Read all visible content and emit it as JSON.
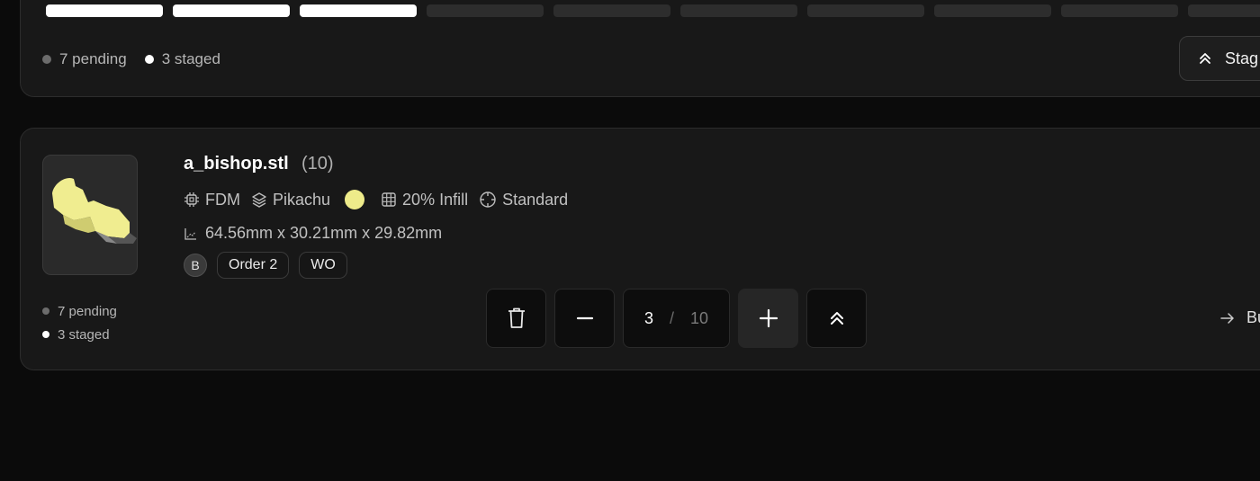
{
  "top_card": {
    "progress": {
      "segments_total": 10,
      "segments_filled": 3
    },
    "pending_label": "7 pending",
    "staged_label": "3 staged",
    "stage_button_label": "Stag"
  },
  "item": {
    "filename": "a_bishop.stl",
    "count": "(10)",
    "tech": "FDM",
    "material": "Pikachu",
    "color_hex": "#eeeb8a",
    "infill": "20% Infill",
    "quality": "Standard",
    "dimensions": "64.56mm x 30.21mm x 29.82mm",
    "avatar_initial": "B",
    "tags": [
      "Order 2",
      "WO"
    ],
    "pending_label": "7 pending",
    "staged_label": "3 staged",
    "quantity_current": "3",
    "quantity_separator": "/",
    "quantity_total": "10",
    "next_link_label": "Bu"
  },
  "icons": {
    "trash": "trash-icon",
    "minus": "minus-icon",
    "plus": "plus-icon",
    "stage": "chevrons-up-icon",
    "arrow": "arrow-right-icon"
  }
}
